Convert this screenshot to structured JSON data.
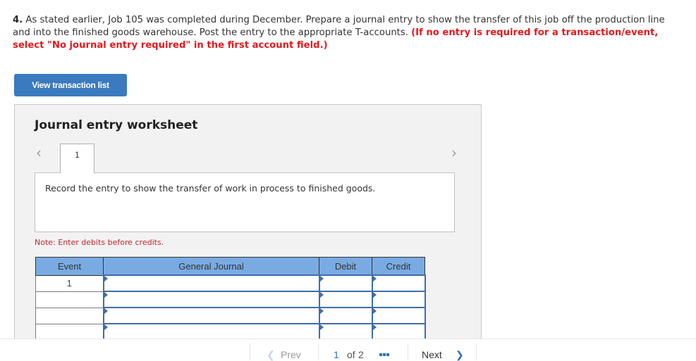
{
  "question": {
    "number": "4.",
    "text": "As stated earlier, Job 105 was completed during December. Prepare a journal entry to show the transfer of this job off the production line and into the finished goods warehouse. Post the entry to the appropriate T-accounts.",
    "instruction": "(If no entry is required for a transaction/event, select \"No journal entry required\" in the first account field.)"
  },
  "view_transaction_button": "View transaction list",
  "worksheet": {
    "title": "Journal entry worksheet",
    "prev_icon": "chevron-left-icon",
    "next_icon": "chevron-right-icon",
    "tabs": [
      {
        "label": "1"
      }
    ],
    "description": "Record the entry to show the transfer of work in process to finished goods.",
    "note": "Note: Enter debits before credits.",
    "table": {
      "headers": [
        "Event",
        "General Journal",
        "Debit",
        "Credit"
      ],
      "rows": [
        {
          "event": "1",
          "account": "",
          "debit": "",
          "credit": ""
        },
        {
          "event": "",
          "account": "",
          "debit": "",
          "credit": ""
        },
        {
          "event": "",
          "account": "",
          "debit": "",
          "credit": ""
        },
        {
          "event": "",
          "account": "",
          "debit": "",
          "credit": ""
        }
      ]
    }
  },
  "bottom_nav": {
    "prev_label": "Prev",
    "page_current": "1",
    "page_of": "of",
    "page_total": "2",
    "next_label": "Next"
  }
}
